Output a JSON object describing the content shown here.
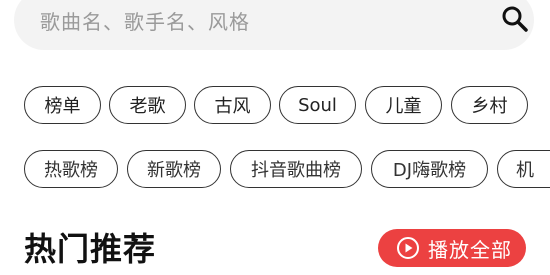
{
  "search": {
    "placeholder": "歌曲名、歌手名、风格"
  },
  "tags_row1": [
    "榜单",
    "老歌",
    "古风",
    "Soul",
    "儿童",
    "乡村"
  ],
  "tags_row2": [
    "热歌榜",
    "新歌榜",
    "抖音歌曲榜",
    "DJ嗨歌榜",
    "机"
  ],
  "section": {
    "title": "热门推荐",
    "play_all_label": "播放全部"
  },
  "colors": {
    "accent": "#ec4141",
    "search_bg": "#f3f3f3"
  },
  "icons": {
    "search": "search-icon",
    "play": "play-circle-icon"
  }
}
